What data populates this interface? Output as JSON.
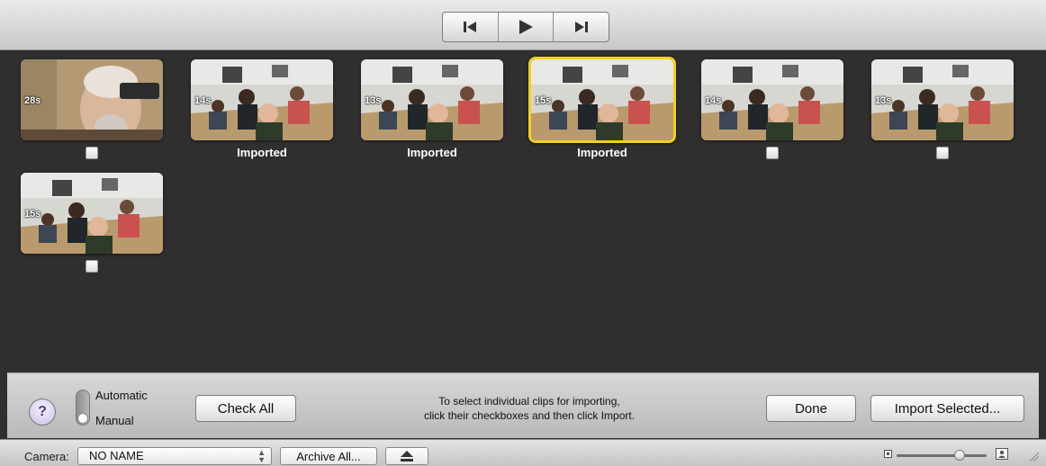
{
  "transport": {
    "buttons": [
      {
        "name": "previous-clip-button",
        "icon": "skip-back-icon"
      },
      {
        "name": "play-button",
        "icon": "play-icon"
      },
      {
        "name": "next-clip-button",
        "icon": "skip-forward-icon"
      }
    ]
  },
  "clips": [
    {
      "duration": "28s",
      "imported": false,
      "checked": false,
      "selected": false,
      "scene": "closeup"
    },
    {
      "duration": "14s",
      "imported": true,
      "status": "Imported",
      "selected": false,
      "scene": "classroom"
    },
    {
      "duration": "13s",
      "imported": true,
      "status": "Imported",
      "selected": false,
      "scene": "classroom"
    },
    {
      "duration": "15s",
      "imported": true,
      "status": "Imported",
      "selected": true,
      "scene": "classroom"
    },
    {
      "duration": "14s",
      "imported": false,
      "checked": false,
      "selected": false,
      "scene": "classroom"
    },
    {
      "duration": "13s",
      "imported": false,
      "checked": false,
      "selected": false,
      "scene": "classroom"
    },
    {
      "duration": "15s",
      "imported": false,
      "checked": false,
      "selected": false,
      "scene": "classroom"
    }
  ],
  "panel": {
    "help_label": "?",
    "mode_automatic": "Automatic",
    "mode_manual": "Manual",
    "mode_selected": "Manual",
    "check_all_label": "Check All",
    "instructions_line1": "To select individual clips for importing,",
    "instructions_line2": "click their checkboxes and then click Import.",
    "done_label": "Done",
    "import_selected_label": "Import Selected..."
  },
  "statusbar": {
    "camera_label": "Camera:",
    "camera_value": "NO NAME",
    "archive_all_label": "Archive All...",
    "eject_icon": "eject-icon",
    "zoom_level": 0.7
  },
  "colors": {
    "selection": "#f3d11b",
    "browser_bg": "#2f2f2f"
  }
}
